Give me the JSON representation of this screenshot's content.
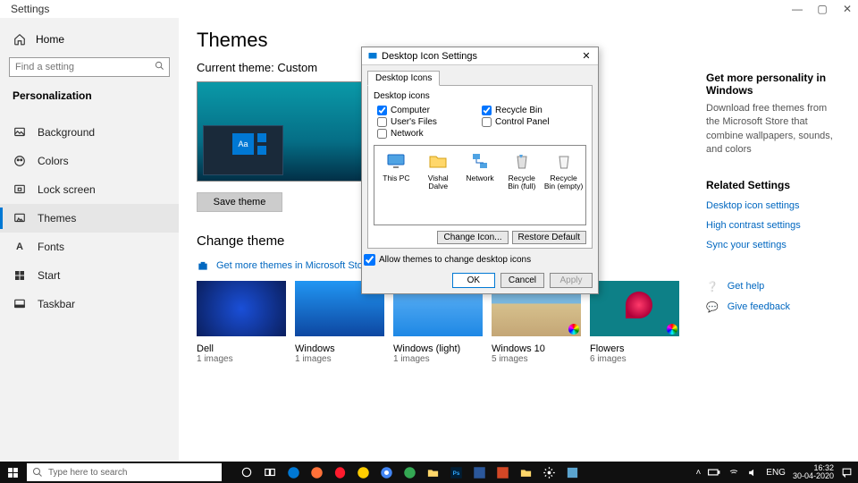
{
  "window": {
    "title": "Settings"
  },
  "sidebar": {
    "home": "Home",
    "searchPlaceholder": "Find a setting",
    "category": "Personalization",
    "items": [
      {
        "label": "Background"
      },
      {
        "label": "Colors"
      },
      {
        "label": "Lock screen"
      },
      {
        "label": "Themes"
      },
      {
        "label": "Fonts"
      },
      {
        "label": "Start"
      },
      {
        "label": "Taskbar"
      }
    ]
  },
  "main": {
    "title": "Themes",
    "currentTheme": "Current theme: Custom",
    "previewTile": "Aa",
    "saveButton": "Save theme",
    "changeThemeHeading": "Change theme",
    "storeLink": "Get more themes in Microsoft Store",
    "themes": [
      {
        "name": "Dell",
        "count": "1 images"
      },
      {
        "name": "Windows",
        "count": "1 images"
      },
      {
        "name": "Windows (light)",
        "count": "1 images"
      },
      {
        "name": "Windows 10",
        "count": "5 images"
      },
      {
        "name": "Flowers",
        "count": "6 images"
      }
    ]
  },
  "right": {
    "heading1": "Get more personality in Windows",
    "sub": "Download free themes from the Microsoft Store that combine wallpapers, sounds, and colors",
    "heading2": "Related Settings",
    "links": [
      "Desktop icon settings",
      "High contrast settings",
      "Sync your settings"
    ],
    "help": "Get help",
    "feedback": "Give feedback"
  },
  "dialog": {
    "title": "Desktop Icon Settings",
    "tab": "Desktop Icons",
    "group": "Desktop icons",
    "checks": {
      "computer": "Computer",
      "usersFiles": "User's Files",
      "network": "Network",
      "recycleBin": "Recycle Bin",
      "controlPanel": "Control Panel"
    },
    "checked": {
      "computer": true,
      "recycleBin": true,
      "usersFiles": false,
      "network": false,
      "controlPanel": false
    },
    "icons": [
      "This PC",
      "Vishal Dalve",
      "Network",
      "Recycle Bin (full)",
      "Recycle Bin (empty)"
    ],
    "changeIcon": "Change Icon...",
    "restoreDefault": "Restore Default",
    "allow": "Allow themes to change desktop icons",
    "allowChecked": true,
    "ok": "OK",
    "cancel": "Cancel",
    "apply": "Apply"
  },
  "taskbar": {
    "searchPlaceholder": "Type here to search",
    "lang": "ENG",
    "time": "16:32",
    "date": "30-04-2020"
  }
}
